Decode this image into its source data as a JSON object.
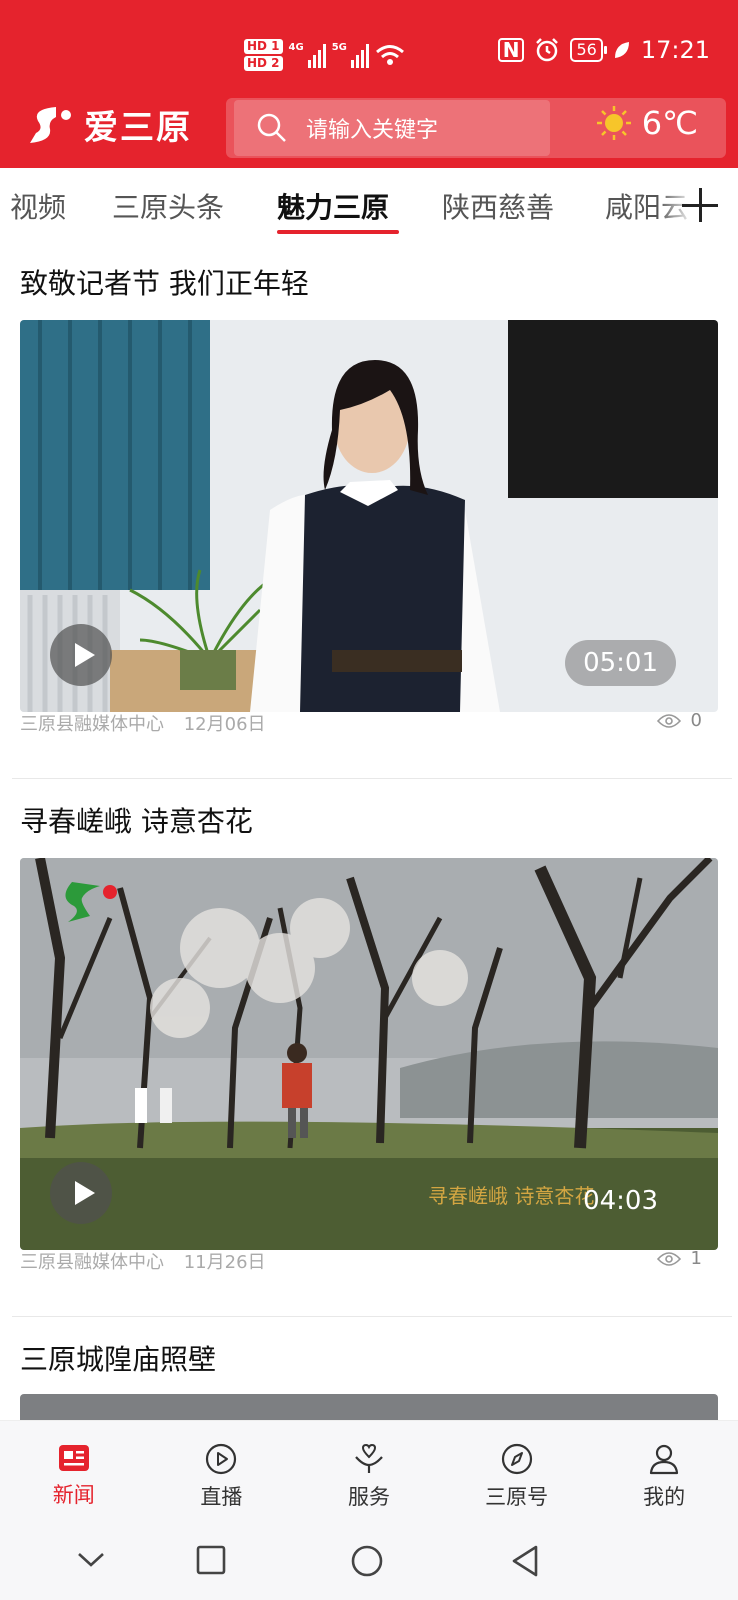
{
  "status_bar": {
    "hd1": "HD 1",
    "hd2": "HD 2",
    "net1": "4G",
    "net2": "5G",
    "nfc": "N",
    "battery": "56",
    "time": "17:21"
  },
  "header": {
    "app_name": "爱三原",
    "search_placeholder": "请输入关键字",
    "weather_temp": "6℃",
    "weather_icon": "sun-icon",
    "accent_color": "#e5232d"
  },
  "tabs": [
    {
      "label": "视频"
    },
    {
      "label": "三原头条"
    },
    {
      "label": "魅力三原",
      "active": true
    },
    {
      "label": "陕西慈善"
    },
    {
      "label": "咸阳云"
    }
  ],
  "articles": [
    {
      "title": "致敬记者节 我们正年轻",
      "duration": "05:01",
      "source": "三原县融媒体中心",
      "date": "12月06日",
      "views": "0"
    },
    {
      "title": "寻春嵯峨 诗意杏花",
      "duration": "04:03",
      "source": "三原县融媒体中心",
      "date": "11月26日",
      "views": "1",
      "caption": "寻春嵯峨 诗意杏花"
    },
    {
      "title": "三原城隍庙照壁"
    }
  ],
  "bottom_nav": [
    {
      "label": "新闻",
      "icon": "news-icon",
      "active": true
    },
    {
      "label": "直播",
      "icon": "play-circle-icon"
    },
    {
      "label": "服务",
      "icon": "heart-hand-icon"
    },
    {
      "label": "三原号",
      "icon": "compass-icon"
    },
    {
      "label": "我的",
      "icon": "user-icon"
    }
  ]
}
